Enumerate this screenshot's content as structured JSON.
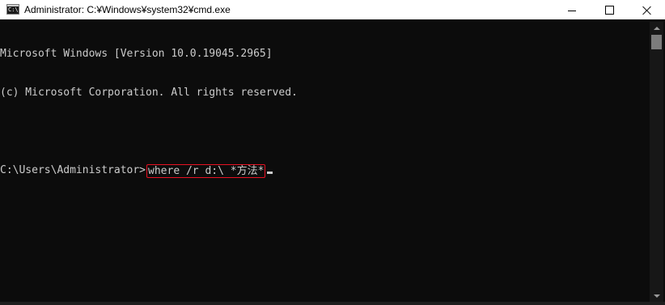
{
  "window": {
    "title": "Administrator: C:¥Windows¥system32¥cmd.exe",
    "icon_text": "C:\\.",
    "icon_name": "cmd-icon",
    "controls": {
      "minimize_icon": "minimize-icon",
      "maximize_icon": "maximize-icon",
      "close_icon": "close-icon"
    }
  },
  "console": {
    "lines": [
      "Microsoft Windows [Version 10.0.19045.2965]",
      "(c) Microsoft Corporation. All rights reserved.",
      ""
    ],
    "prompt": "C:\\Users\\Administrator>",
    "command": "where /r d:\\ *方法*",
    "colors": {
      "background": "#0c0c0c",
      "text": "#cccccc",
      "highlight_border": "#e81123"
    }
  }
}
